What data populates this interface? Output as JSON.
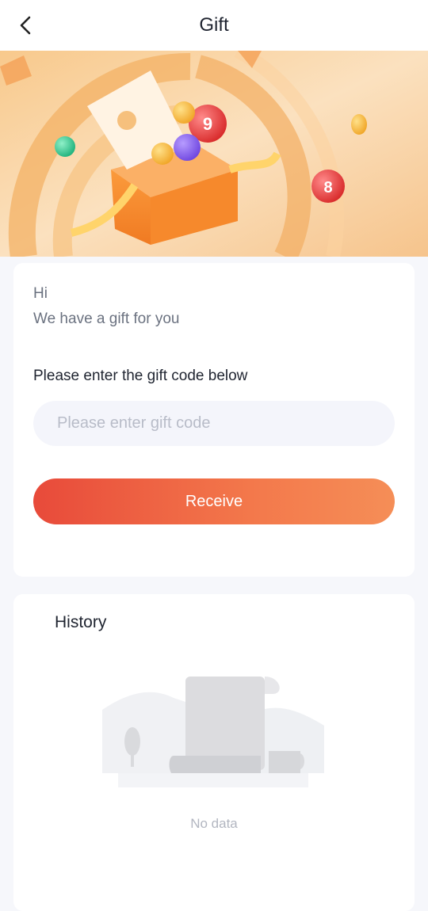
{
  "header": {
    "title": "Gift"
  },
  "gift_form": {
    "greeting": "Hi",
    "subtitle": "We have a gift for you",
    "code_label": "Please enter the gift code below",
    "code_placeholder": "Please enter gift code",
    "code_value": "",
    "receive_label": "Receive"
  },
  "history": {
    "title": "History",
    "empty_text": "No data"
  },
  "colors": {
    "accent_start": "#e84a3a",
    "accent_end": "#f58e57",
    "background": "#f6f7fb"
  },
  "icons": {
    "back": "chevron-left-icon",
    "empty": "empty-document-illustration"
  }
}
